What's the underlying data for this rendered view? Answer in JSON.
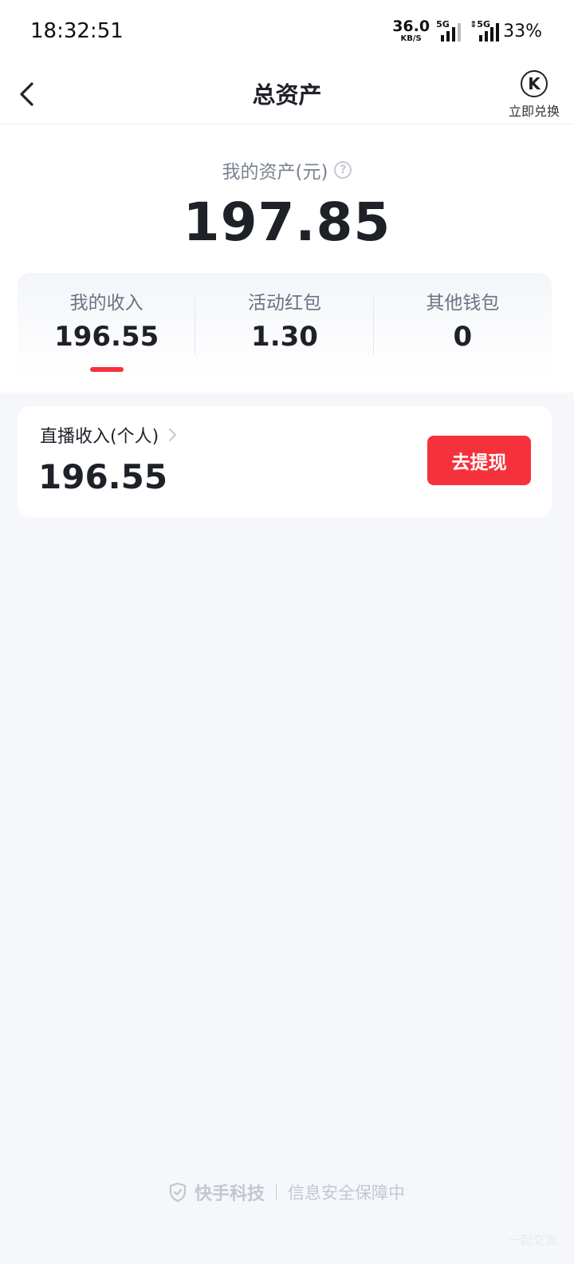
{
  "status_bar": {
    "time": "18:32:51",
    "net_speed": "36.0",
    "net_unit": "KB/S",
    "sim1_label": "5G",
    "sim2_label": "⇕5G",
    "battery": "33%"
  },
  "nav": {
    "title": "总资产",
    "exchange_icon_letter": "K",
    "exchange_label": "立即兑换"
  },
  "assets": {
    "label": "我的资产(元)",
    "help_symbol": "?",
    "total": "197.85"
  },
  "tabs": [
    {
      "label": "我的收入",
      "value": "196.55",
      "active": true
    },
    {
      "label": "活动红包",
      "value": "1.30",
      "active": false
    },
    {
      "label": "其他钱包",
      "value": "0",
      "active": false
    }
  ],
  "income_card": {
    "title": "直播收入(个人)",
    "amount": "196.55",
    "withdraw_label": "去提现"
  },
  "footer": {
    "brand": "快手科技",
    "text": "信息安全保障中"
  },
  "watermark": "一起交流",
  "colors": {
    "accent": "#f5323c",
    "background": "#f5f7fb",
    "text_primary": "#1f2129",
    "text_secondary": "#7b8191"
  },
  "icons": [
    "back-icon",
    "k-coin-icon",
    "help-icon",
    "chevron-right-icon",
    "shield-icon",
    "signal-icon"
  ]
}
